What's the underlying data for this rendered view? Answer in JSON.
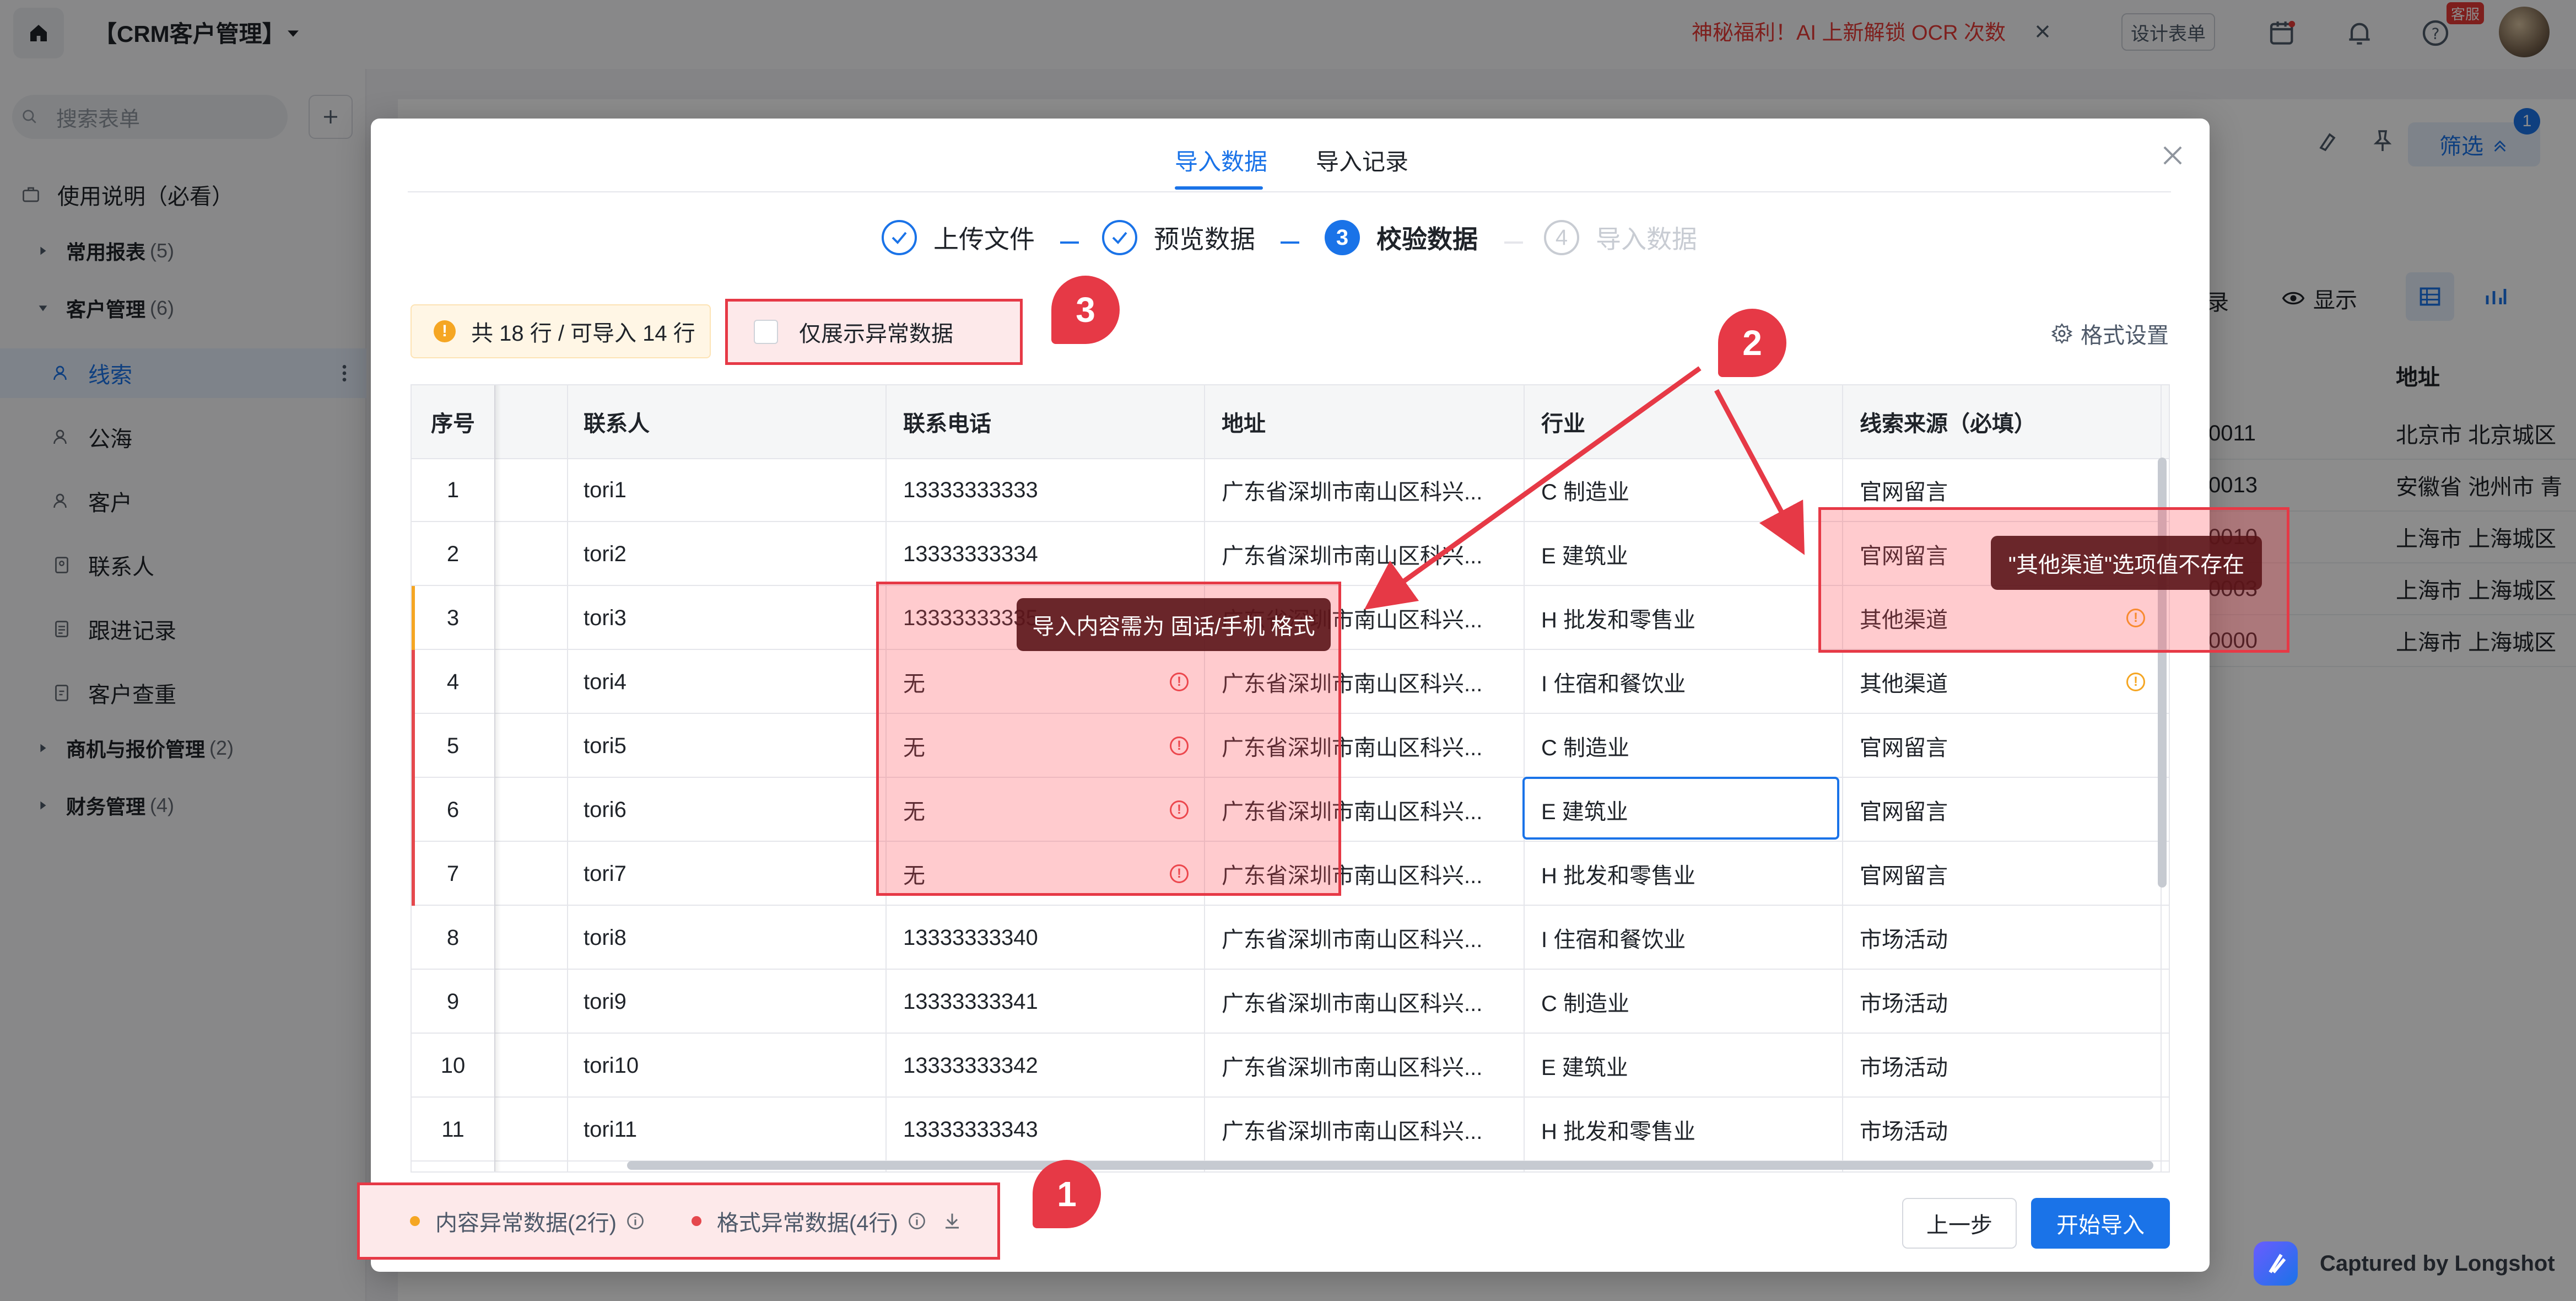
{
  "app": {
    "title": "【CRM客户管理】",
    "promo": "神秘福利！AI 上新解锁 OCR 次数",
    "design_form": "设计表单",
    "support_badge": "客服",
    "search_placeholder": "搜索表单"
  },
  "sidebar": {
    "guide": "使用说明（必看）",
    "groups": [
      {
        "label": "常用报表",
        "count": "(5)"
      },
      {
        "label": "客户管理",
        "count": "(6)"
      },
      {
        "label": "商机与报价管理",
        "count": "(2)"
      },
      {
        "label": "财务管理",
        "count": "(4)"
      }
    ],
    "items": [
      "线索",
      "公海",
      "客户",
      "联系人",
      "跟进记录",
      "客户查重"
    ]
  },
  "background": {
    "filter": "筛选",
    "filter_badge": "1",
    "record": "录",
    "display": "显示",
    "address_header": "地址",
    "rows": [
      {
        "code": "0011",
        "addr": "北京市 北京城区"
      },
      {
        "code": "0013",
        "addr": "安徽省 池州市 青"
      },
      {
        "code": "0010",
        "addr": "上海市 上海城区"
      },
      {
        "code": "0003",
        "addr": "上海市 上海城区"
      },
      {
        "code": "0000",
        "addr": "上海市 上海城区"
      }
    ]
  },
  "modal": {
    "tabs": [
      "导入数据",
      "导入记录"
    ],
    "steps": [
      {
        "num": "1",
        "label": "上传文件"
      },
      {
        "num": "2",
        "label": "预览数据"
      },
      {
        "num": "3",
        "label": "校验数据"
      },
      {
        "num": "4",
        "label": "导入数据"
      }
    ],
    "summary": "共 18 行 / 可导入 14 行",
    "only_abnormal": "仅展示异常数据",
    "format_settings": "格式设置",
    "table": {
      "headers": [
        "序号",
        "联系人",
        "联系电话",
        "地址",
        "行业",
        "线索来源（必填）"
      ],
      "rows": [
        {
          "idx": "1",
          "contact": "tori1",
          "phone": "13333333333",
          "addr": "广东省深圳市南山区科兴...",
          "industry": "C 制造业",
          "source": "官网留言"
        },
        {
          "idx": "2",
          "contact": "tori2",
          "phone": "13333333334",
          "addr": "广东省深圳市南山区科兴...",
          "industry": "E 建筑业",
          "source": "官网留言"
        },
        {
          "idx": "3",
          "contact": "tori3",
          "phone": "13333333335",
          "addr": "广东省深圳市南山区科兴...",
          "industry": "H 批发和零售业",
          "source": "其他渠道"
        },
        {
          "idx": "4",
          "contact": "tori4",
          "phone": "无",
          "addr": "广东省深圳市南山区科兴...",
          "industry": "I 住宿和餐饮业",
          "source": "其他渠道"
        },
        {
          "idx": "5",
          "contact": "tori5",
          "phone": "无",
          "addr": "广东省深圳市南山区科兴...",
          "industry": "C 制造业",
          "source": "官网留言"
        },
        {
          "idx": "6",
          "contact": "tori6",
          "phone": "无",
          "addr": "广东省深圳市南山区科兴...",
          "industry": "E 建筑业",
          "source": "官网留言"
        },
        {
          "idx": "7",
          "contact": "tori7",
          "phone": "无",
          "addr": "广东省深圳市南山区科兴...",
          "industry": "H 批发和零售业",
          "source": "官网留言"
        },
        {
          "idx": "8",
          "contact": "tori8",
          "phone": "13333333340",
          "addr": "广东省深圳市南山区科兴...",
          "industry": "I 住宿和餐饮业",
          "source": "市场活动"
        },
        {
          "idx": "9",
          "contact": "tori9",
          "phone": "13333333341",
          "addr": "广东省深圳市南山区科兴...",
          "industry": "C 制造业",
          "source": "市场活动"
        },
        {
          "idx": "10",
          "contact": "tori10",
          "phone": "13333333342",
          "addr": "广东省深圳市南山区科兴...",
          "industry": "E 建筑业",
          "source": "市场活动"
        },
        {
          "idx": "11",
          "contact": "tori11",
          "phone": "13333333343",
          "addr": "广东省深圳市南山区科兴...",
          "industry": "H 批发和零售业",
          "source": "市场活动"
        }
      ]
    },
    "tooltip_phone": "导入内容需为 固话/手机 格式",
    "tooltip_source": "\"其他渠道\"选项值不存在",
    "legend_content": "内容异常数据(2行)",
    "legend_format": "格式异常数据(4行)",
    "prev": "上一步",
    "start": "开始导入"
  },
  "annotations": [
    "1",
    "2",
    "3"
  ],
  "capture": "Captured by Longshot",
  "colors": {
    "accent": "#1a73e8",
    "error": "#e5484d",
    "warning": "#f5a623",
    "annotation": "#e63946"
  }
}
